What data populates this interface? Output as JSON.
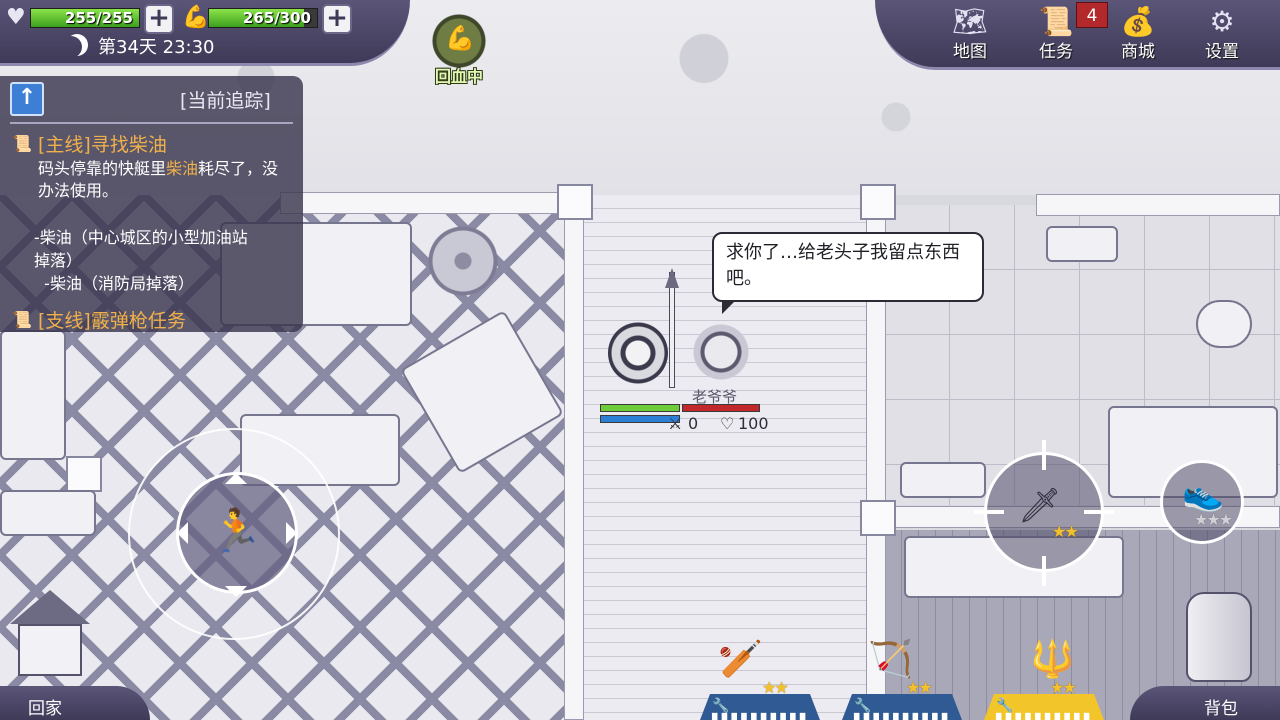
{
  "status": {
    "health": {
      "icon": "heart-icon",
      "value_text": "255/255",
      "fraction": 1.0
    },
    "stamina": {
      "icon": "arm-icon",
      "value_text": "265/300",
      "fraction": 0.883
    },
    "plus": "+",
    "day_text": "第34天 23:30"
  },
  "buff": {
    "icon": "muscle-icon",
    "label": "回血中"
  },
  "menu": {
    "map": {
      "icon": "map-icon",
      "label": "地图"
    },
    "tasks": {
      "icon": "scroll-icon",
      "label": "任务",
      "badge": "4"
    },
    "shop": {
      "icon": "coins-icon",
      "label": "商城"
    },
    "settings": {
      "icon": "gear-icon",
      "label": "设置"
    }
  },
  "quest": {
    "header": "[当前追踪]",
    "main_title": "[主线]寻找柴油",
    "desc_part1": "码头停靠的快艇里",
    "desc_highlight": "柴油",
    "desc_part2": "耗尽了，没办法使用。",
    "items": "-柴油（中心城区的小型加油站\n掉落）\n  -柴油（消防局掉落）",
    "side_title": "[支线]霰弹枪任务"
  },
  "dialogue": {
    "text": "求你了…给老头子我留点东西吧。"
  },
  "npc": {
    "name": "老爷爷",
    "stat_left": "0",
    "stat_right": "100"
  },
  "controls": {
    "home_label": "回家",
    "bag_label": "背包",
    "attack_stars": "★★",
    "skill_stars": "★★★"
  },
  "weapon_slots": [
    {
      "stars": "★★",
      "durability": "🔧 ▌▌▌▌▌▌▌▌▌▌"
    },
    {
      "stars": "★★",
      "durability": "🔧 ▌▌▌▌▌▌▌▌▌▌"
    },
    {
      "stars": "★★",
      "durability": "🔧 ▌▌▌▌▌▌▌▌▌▌"
    }
  ],
  "colors": {
    "hud_bg": "#4a4566",
    "health_green": "#5fd12e",
    "quest_orange": "#f0b14a",
    "slot_blue": "#2f5a93",
    "slot_gold": "#f2c52b"
  }
}
